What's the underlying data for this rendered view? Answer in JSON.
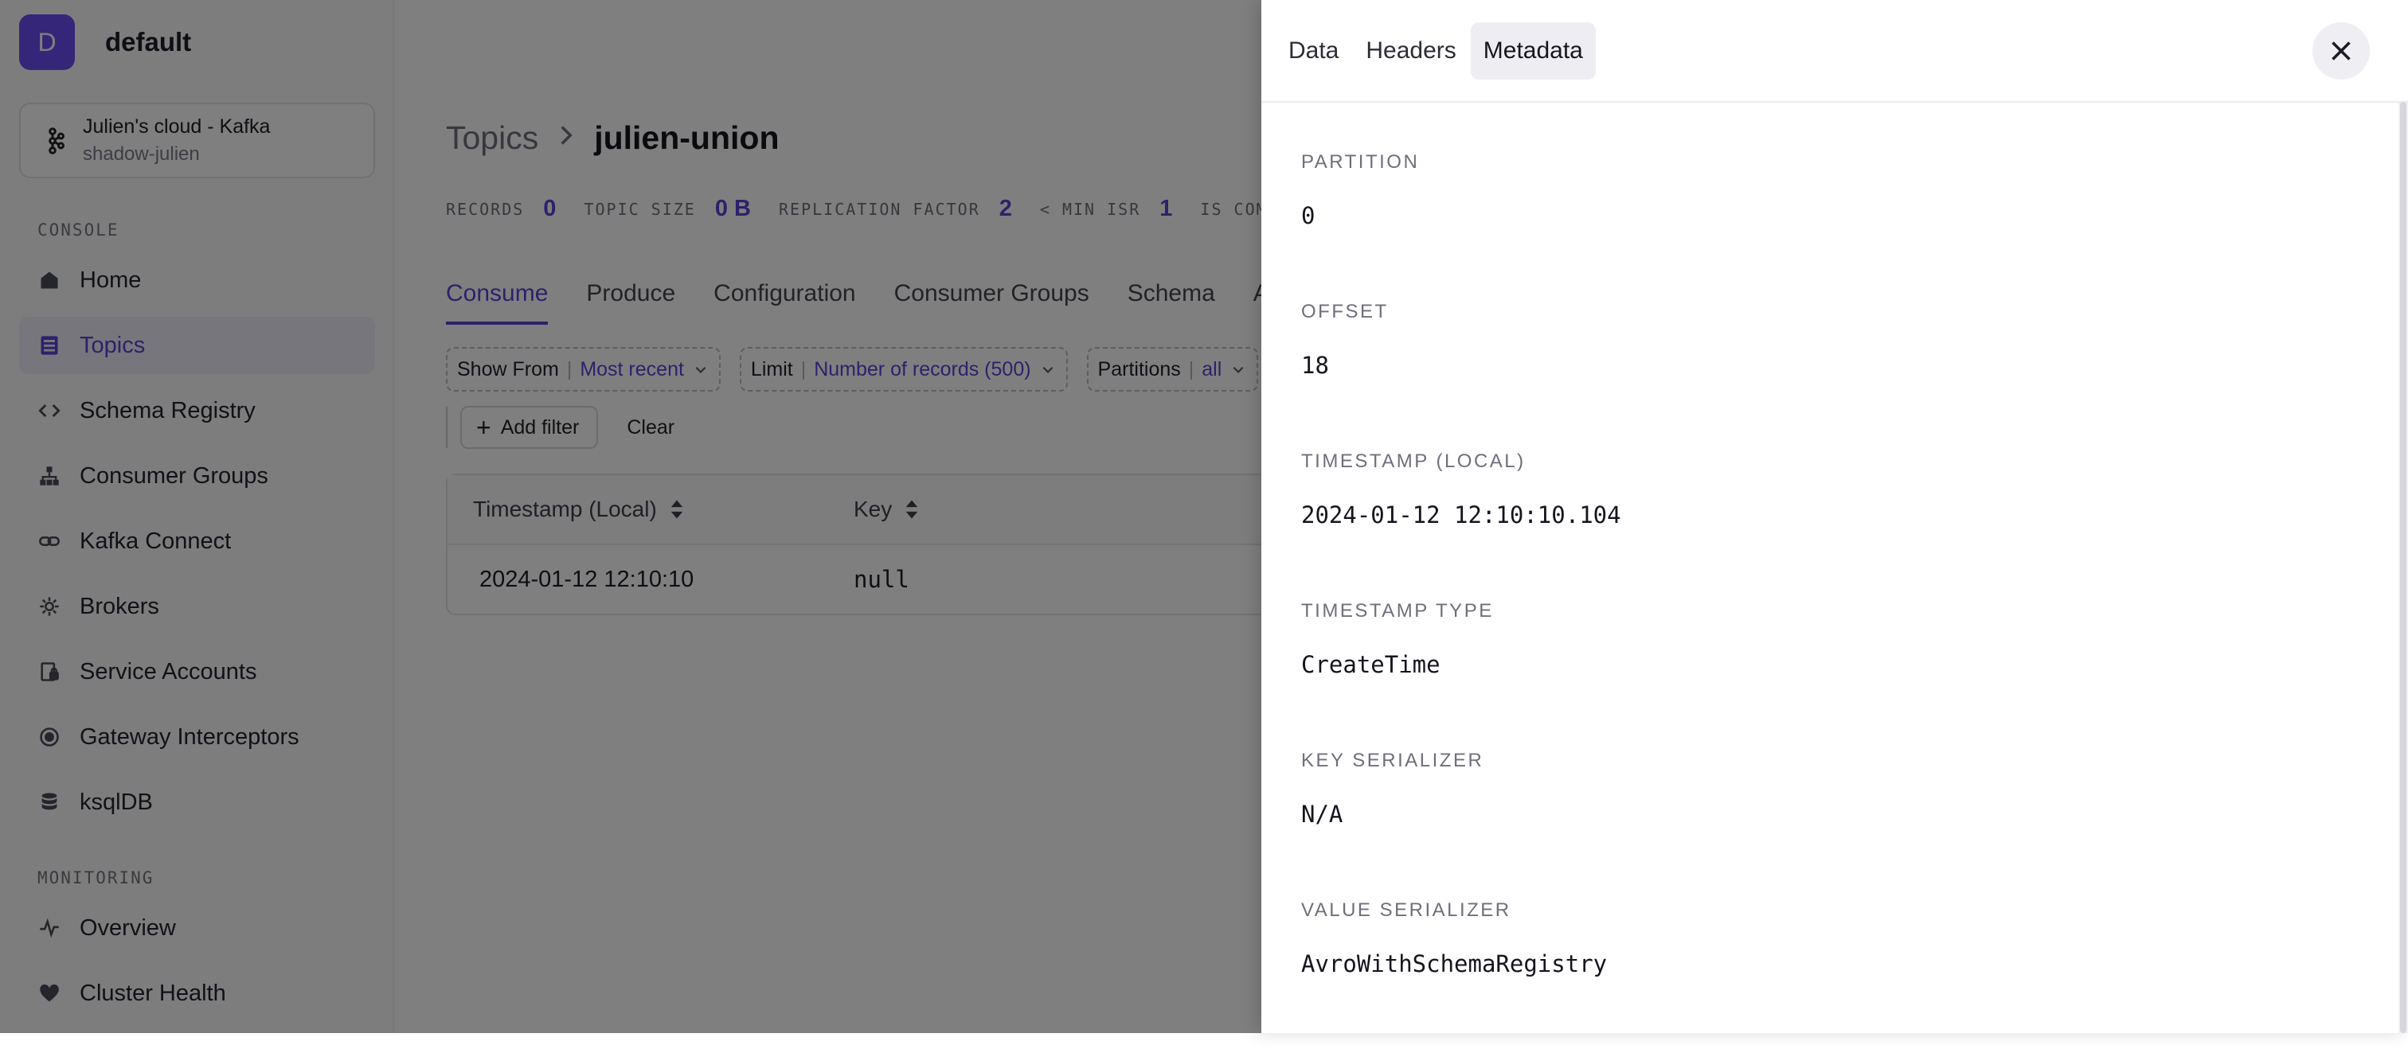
{
  "workspace": {
    "initial": "D",
    "name": "default"
  },
  "cluster": {
    "name": "Julien's cloud - Kafka",
    "sub": "shadow-julien",
    "icon": "kafka-icon"
  },
  "sidebar": {
    "console_label": "CONSOLE",
    "monitoring_label": "MONITORING",
    "items": [
      {
        "label": "Home",
        "icon": "home-icon"
      },
      {
        "label": "Topics",
        "icon": "topics-icon",
        "active": true
      },
      {
        "label": "Schema Registry",
        "icon": "code-icon"
      },
      {
        "label": "Consumer Groups",
        "icon": "hierarchy-icon"
      },
      {
        "label": "Kafka Connect",
        "icon": "link-icon"
      },
      {
        "label": "Brokers",
        "icon": "cog-icon"
      },
      {
        "label": "Service Accounts",
        "icon": "lock-icon"
      },
      {
        "label": "Gateway Interceptors",
        "icon": "gateway-icon"
      },
      {
        "label": "ksqlDB",
        "icon": "database-icon"
      }
    ],
    "monitoring_items": [
      {
        "label": "Overview",
        "icon": "pulse-icon"
      },
      {
        "label": "Cluster Health",
        "icon": "heart-icon"
      }
    ]
  },
  "breadcrumb": {
    "parent": "Topics",
    "current": "julien-union"
  },
  "stats": [
    {
      "label": "RECORDS",
      "value": "0"
    },
    {
      "label": "TOPIC SIZE",
      "value": "0 B"
    },
    {
      "label": "REPLICATION FACTOR",
      "value": "2"
    },
    {
      "label": "< MIN ISR",
      "value": "1"
    },
    {
      "label": "IS COM",
      "value": ""
    }
  ],
  "tabs": [
    "Consume",
    "Produce",
    "Configuration",
    "Consumer Groups",
    "Schema",
    "AC"
  ],
  "filters": [
    {
      "key": "Show From",
      "value": "Most recent"
    },
    {
      "key": "Limit",
      "value": "Number of records (500)"
    },
    {
      "key": "Partitions",
      "value": "all"
    }
  ],
  "actions": {
    "add_filter": "Add filter",
    "clear": "Clear"
  },
  "table": {
    "columns": [
      "Timestamp (Local)",
      "Key"
    ],
    "rows": [
      {
        "timestamp": "2024-01-12 12:10:10",
        "key": "null"
      }
    ]
  },
  "drawer": {
    "tabs": [
      "Data",
      "Headers",
      "Metadata"
    ],
    "active_tab": "Metadata",
    "fields": [
      {
        "label": "PARTITION",
        "value": "0"
      },
      {
        "label": "OFFSET",
        "value": "18"
      },
      {
        "label": "TIMESTAMP (LOCAL)",
        "value": "2024-01-12 12:10:10.104"
      },
      {
        "label": "TIMESTAMP TYPE",
        "value": "CreateTime"
      },
      {
        "label": "KEY SERIALIZER",
        "value": "N/A"
      },
      {
        "label": "VALUE SERIALIZER",
        "value": "AvroWithSchemaRegistry"
      }
    ]
  },
  "colors": {
    "accent": "#5b43d6",
    "avatar": "#6a4cf3",
    "overlay": "rgba(0,0,0,0.5)"
  }
}
